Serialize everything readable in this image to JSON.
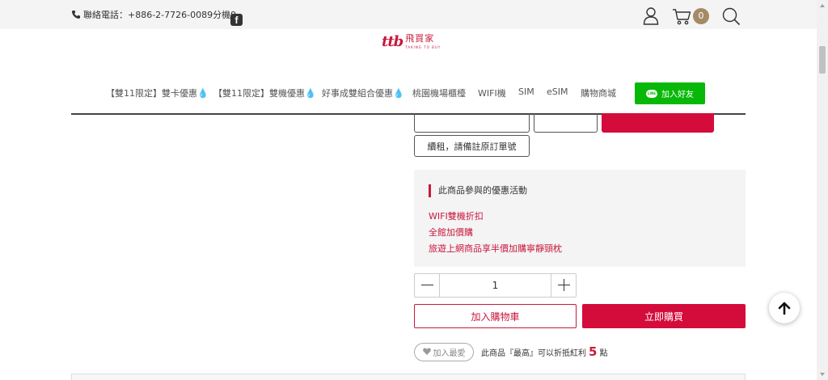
{
  "header": {
    "phone_label": "聯絡電話：",
    "phone_number": "+886-2-7726-0089分機9",
    "facebook_glyph": "f",
    "cart_count": "0",
    "icons": [
      "phone-icon",
      "facebook-icon",
      "user-icon",
      "cart-icon",
      "search-icon"
    ]
  },
  "logo": {
    "mark": "ttb",
    "name_zh": "飛買家",
    "name_en": "TAKING TO BUY"
  },
  "nav": {
    "items": [
      {
        "label": "【雙11限定】雙卡優惠",
        "fire": "💧"
      },
      {
        "label": "【雙11限定】雙機優惠",
        "fire": "💧"
      },
      {
        "label": "好事成雙組合優惠",
        "fire": "💧"
      },
      {
        "label": "桃園機場櫃檯",
        "fire": ""
      },
      {
        "label": "WIFI機",
        "fire": ""
      },
      {
        "label": "SIM",
        "fire": ""
      },
      {
        "label": "eSIM",
        "fire": ""
      },
      {
        "label": "購物商城",
        "fire": ""
      }
    ],
    "line_logo": "LINE",
    "line_label": "加入好友"
  },
  "options": {
    "renew_label": "續租，請備註原訂單號"
  },
  "promo": {
    "title": "此商品參與的優惠活動",
    "links": [
      "WIFI雙機折扣",
      "全館加價購",
      "旅遊上網商品享半價加購寧靜頸枕"
    ]
  },
  "purchase": {
    "quantity": "1",
    "add_to_cart": "加入購物車",
    "buy_now": "立即購買",
    "favorite": "加入最愛",
    "bonus_prefix": "此商品『最高』可以折抵紅利",
    "bonus_points": "5",
    "bonus_suffix": "點"
  },
  "colors": {
    "brand_red": "#d40c3c",
    "line_green": "#08b808",
    "badge_gold": "#a58a67",
    "promo_bg": "#f4f4f4"
  }
}
